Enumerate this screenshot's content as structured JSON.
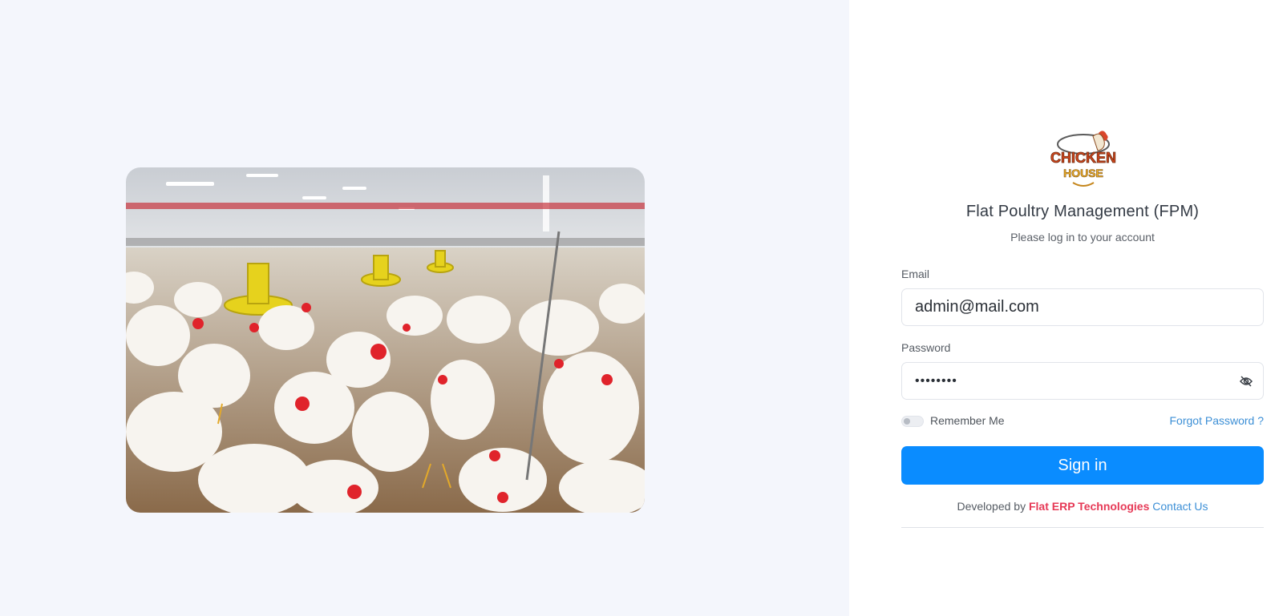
{
  "app": {
    "title": "Flat Poultry Management (FPM)",
    "subtitle": "Please log in to your account",
    "logo_text_top": "CHICKEN",
    "logo_text_bottom": "HOUSE"
  },
  "form": {
    "email_label": "Email",
    "email_value": "admin@mail.com",
    "password_label": "Password",
    "password_value": "••••••••",
    "password_toggle_icon": "eye-off-icon",
    "remember_label": "Remember Me",
    "remember_checked": false,
    "forgot_label": "Forgot Password ?",
    "sign_in_label": "Sign in"
  },
  "footer": {
    "developed_by_label": "Developed by",
    "brand_name": "Flat ERP Technologies",
    "contact_label": "Contact Us"
  },
  "colors": {
    "primary": "#0a8cff",
    "link": "#3c8fd6",
    "brand": "#e63956",
    "left_background": "#f4f6fc"
  },
  "hero": {
    "description_icon": "poultry-farm-photo"
  }
}
